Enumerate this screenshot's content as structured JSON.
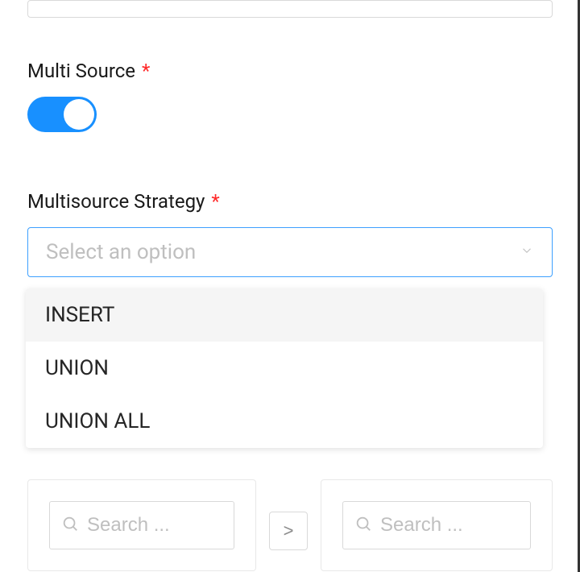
{
  "fields": {
    "multiSource": {
      "label": "Multi Source",
      "required": "*",
      "value": true
    },
    "multisourceStrategy": {
      "label": "Multisource Strategy",
      "required": "*",
      "placeholder": "Select an option",
      "options": [
        "INSERT",
        "UNION",
        "UNION ALL"
      ]
    }
  },
  "transfer": {
    "leftSearchPlaceholder": "Search ...",
    "rightSearchPlaceholder": "Search ...",
    "moveRightLabel": ">"
  }
}
